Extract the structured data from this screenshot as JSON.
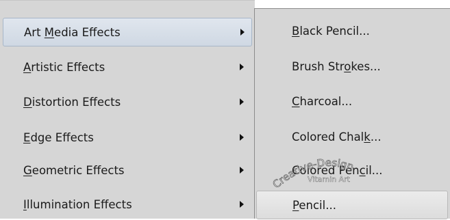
{
  "submenu_left": {
    "items": [
      {
        "pre": "Art ",
        "key": "M",
        "post": "edia Effects"
      },
      {
        "pre": "",
        "key": "A",
        "post": "rtistic Effects"
      },
      {
        "pre": "",
        "key": "D",
        "post": "istortion Effects"
      },
      {
        "pre": "",
        "key": "E",
        "post": "dge Effects"
      },
      {
        "pre": "",
        "key": "G",
        "post": "eometric Effects"
      },
      {
        "pre": "",
        "key": "I",
        "post": "llumination Effects"
      }
    ]
  },
  "submenu_right": {
    "items": [
      {
        "pre": "",
        "key": "B",
        "post": "lack Pencil..."
      },
      {
        "pre": "Brush Str",
        "key": "o",
        "post": "kes..."
      },
      {
        "pre": "",
        "key": "C",
        "post": "harcoal..."
      },
      {
        "pre": "Colored Chal",
        "key": "k",
        "post": "..."
      },
      {
        "pre": "Colored Pen",
        "key": "c",
        "post": "il..."
      },
      {
        "pre": "",
        "key": "P",
        "post": "encil..."
      }
    ]
  },
  "watermark": {
    "line1": "Creative-Design",
    "line2": "Vitamin Art"
  },
  "icons": {
    "submenu_arrow": "triangle-right-icon"
  }
}
